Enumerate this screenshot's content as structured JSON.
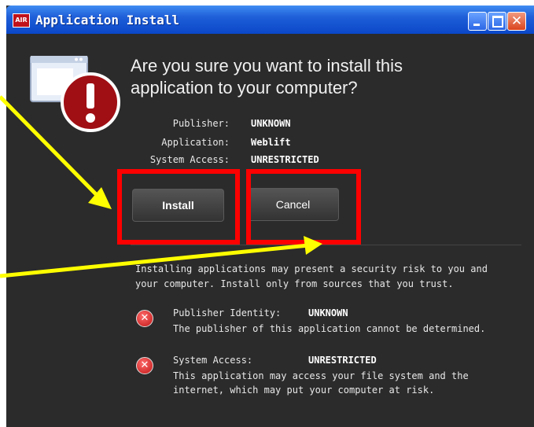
{
  "window": {
    "title": "Application Install",
    "icon_label": "AIR",
    "controls": {
      "minimize": "minimize",
      "maximize": "maximize",
      "close": "✕"
    }
  },
  "dialog": {
    "heading_line1": "Are you sure you want to install this",
    "heading_line2": "application to your computer?",
    "meta": [
      {
        "label": "Publisher:",
        "value": "UNKNOWN"
      },
      {
        "label": "Application:",
        "value": "Weblift"
      },
      {
        "label": "System Access:",
        "value": "UNRESTRICTED"
      }
    ],
    "install_label": "Install",
    "cancel_label": "Cancel",
    "warning_line1": "Installing applications may present a security risk to you and",
    "warning_line2": "your computer. Install only from sources that you trust.",
    "details": [
      {
        "label": "Publisher Identity:",
        "value": "UNKNOWN",
        "desc1": "The publisher of this application cannot be determined.",
        "desc2": ""
      },
      {
        "label": "System Access:",
        "value": "UNRESTRICTED",
        "desc1": "This application may access your file system and the",
        "desc2": "internet, which may put your computer at risk."
      }
    ]
  },
  "colors": {
    "dialog_bg": "#2b2b2b",
    "annotation_red": "#ff0000",
    "annotation_arrow": "#ffff00",
    "titlebar": "#1f5fd8"
  }
}
